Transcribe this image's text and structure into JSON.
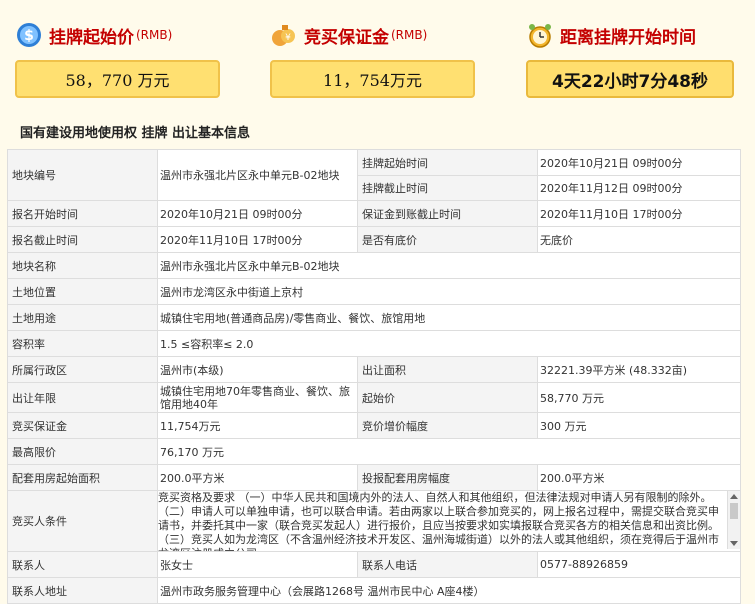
{
  "header": {
    "start_price": {
      "title": "挂牌起始价",
      "unit": "(RMB)",
      "value": "58，770 万元",
      "icon": "dollar-circle-icon"
    },
    "deposit": {
      "title": "竞买保证金",
      "unit": "(RMB)",
      "value": "11，754万元",
      "icon": "money-bag-icon"
    },
    "countdown": {
      "title": "距离挂牌开始时间",
      "value": "4天22小时7分48秒",
      "icon": "alarm-clock-icon"
    }
  },
  "section_title": "国有建设用地使用权 挂牌 出让基本信息",
  "table": {
    "r1": {
      "l1": "地块编号",
      "v1": "温州市永强北片区永中单元B-02地块",
      "l2a": "挂牌起始时间",
      "v2a": "2020年10月21日 09时00分",
      "l2b": "挂牌截止时间",
      "v2b": "2020年11月12日 09时00分"
    },
    "r2": {
      "l1": "报名开始时间",
      "v1": "2020年10月21日 09时00分",
      "l2": "保证金到账截止时间",
      "v2": "2020年11月10日 17时00分"
    },
    "r3": {
      "l1": "报名截止时间",
      "v1": "2020年11月10日 17时00分",
      "l2": "是否有底价",
      "v2": "无底价"
    },
    "r4": {
      "l": "地块名称",
      "v": "温州市永强北片区永中单元B-02地块"
    },
    "r5": {
      "l": "土地位置",
      "v": "温州市龙湾区永中街道上京村"
    },
    "r6": {
      "l": "土地用途",
      "v": "城镇住宅用地(普通商品房)/零售商业、餐饮、旅馆用地"
    },
    "r7": {
      "l": "容积率",
      "v": "1.5 ≤容积率≤ 2.0"
    },
    "r8": {
      "l1": "所属行政区",
      "v1": "温州市(本级)",
      "l2": "出让面积",
      "v2": "32221.39平方米 (48.332亩)"
    },
    "r9": {
      "l1": "出让年限",
      "v1": "城镇住宅用地70年零售商业、餐饮、旅馆用地40年",
      "l2": "起始价",
      "v2": "58,770 万元"
    },
    "r10": {
      "l1": "竞买保证金",
      "v1": "11,754万元",
      "l2": "竞价增价幅度",
      "v2": "300 万元"
    },
    "r11": {
      "l": "最高限价",
      "v": "76,170 万元"
    },
    "r12": {
      "l1": "配套用房起始面积",
      "v1": "200.0平方米",
      "l2": "投报配套用房幅度",
      "v2": "200.0平方米"
    },
    "r13": {
      "l": "竞买人条件",
      "v": "竞买资格及要求 （一）中华人民共和国境内外的法人、自然人和其他组织，但法律法规对申请人另有限制的除外。 （二）申请人可以单独申请，也可以联合申请。若由两家以上联合参加竞买的，网上报名过程中，需提交联合竞买申请书，并委托其中一家（联合竞买发起人）进行报价，且应当按要求如实填报联合竞买各方的相关信息和出资比例。 （三）竞买人如为龙湾区（不含温州经济技术开发区、温州海城街道）以外的法人或其他组织，须在竞得后于温州市龙湾区注册成立公司。"
    },
    "r14": {
      "l1": "联系人",
      "v1": "张女士",
      "l2": "联系人电话",
      "v2": "0577-88926859"
    },
    "r15": {
      "l": "联系人地址",
      "v": "温州市政务服务管理中心（会展路1268号 温州市民中心 A座4楼）"
    }
  }
}
